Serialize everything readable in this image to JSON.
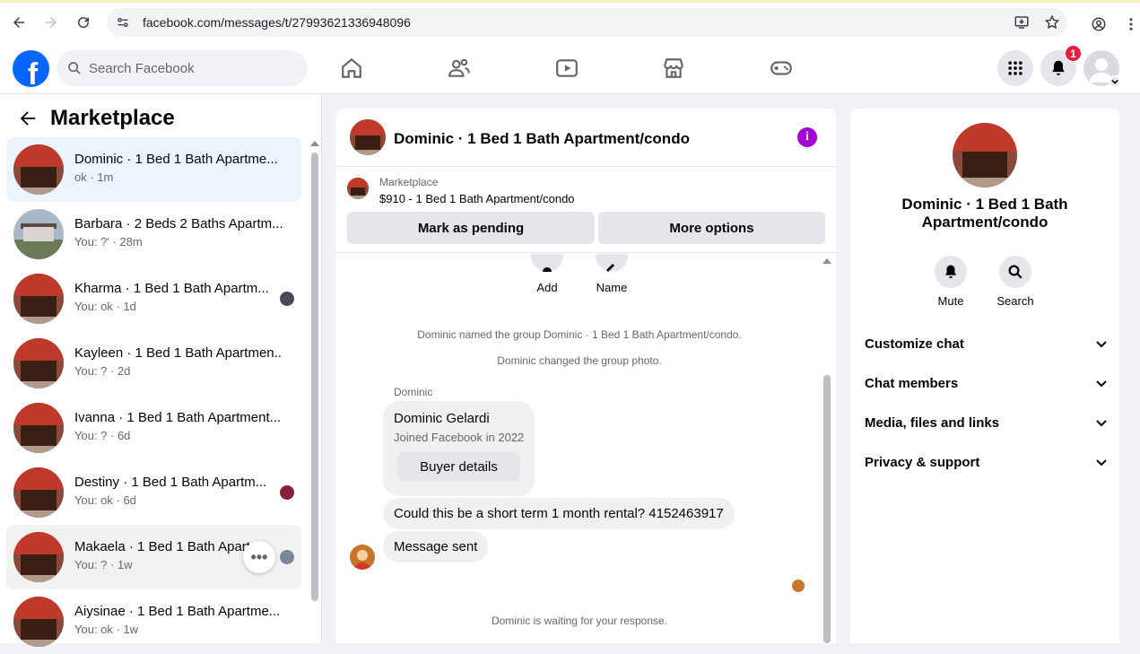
{
  "browser": {
    "url": "facebook.com/messages/t/27993621336948096"
  },
  "header": {
    "logo": "f",
    "search_placeholder": "Search Facebook",
    "notification_count": "1"
  },
  "sidebar": {
    "title": "Marketplace",
    "conversations": [
      {
        "name": "Dominic · 1 Bed 1 Bath Apartme...",
        "sub": "ok · 1m"
      },
      {
        "name": "Barbara · 2 Beds 2 Baths Apartm...",
        "sub": "You: ?' · 28m"
      },
      {
        "name": "Kharma · 1 Bed 1 Bath Apartm...",
        "sub": "You: ok · 1d"
      },
      {
        "name": "Kayleen · 1 Bed 1 Bath Apartmen...",
        "sub": "You: ? · 2d"
      },
      {
        "name": "Ivanna · 1 Bed 1 Bath Apartment...",
        "sub": "You: ? · 6d"
      },
      {
        "name": "Destiny · 1 Bed 1 Bath Apartm...",
        "sub": "You: ok · 6d"
      },
      {
        "name": "Makaela · 1 Bed 1 Bath Apart",
        "sub": "You: ? · 1w"
      },
      {
        "name": "Aiysinae · 1 Bed 1 Bath Apartme...",
        "sub": "You: ok · 1w"
      }
    ]
  },
  "chat": {
    "title": "Dominic · 1 Bed 1 Bath Apartment/condo",
    "marketplace_label": "Marketplace",
    "listing": "$910 - 1 Bed 1 Bath Apartment/condo",
    "mark_pending": "Mark as pending",
    "more_options": "More options",
    "add_label": "Add",
    "name_label": "Name",
    "sys_named": "Dominic named the group Dominic · 1 Bed 1 Bath Apartment/condo.",
    "sys_photo": "Dominic changed the group photo.",
    "sender": "Dominic",
    "card_name": "Dominic Gelardi",
    "card_joined": "Joined Facebook in 2022",
    "buyer_details": "Buyer details",
    "msg1": "Could this be a short term 1 month rental? 4152463917",
    "msg2": "Message sent",
    "waiting": "Dominic is waiting for your response."
  },
  "details": {
    "title": "Dominic · 1 Bed 1 Bath Apartment/condo",
    "mute": "Mute",
    "search": "Search",
    "rows": [
      "Customize chat",
      "Chat members",
      "Media, files and links",
      "Privacy & support"
    ]
  },
  "colors": {
    "brand": "#0866ff",
    "info_accent": "#a200d6",
    "active_conv": "#ebf5ff"
  }
}
